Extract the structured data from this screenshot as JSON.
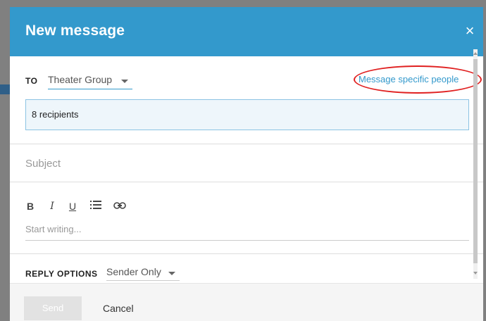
{
  "modal": {
    "title": "New message",
    "close_label": "×"
  },
  "to": {
    "label": "TO",
    "group_value": "Theater Group",
    "specific_link": "Message specific people",
    "recipients_text": "8 recipients"
  },
  "subject": {
    "placeholder": "Subject"
  },
  "toolbar": {
    "bold": "B",
    "italic": "I",
    "underline": "U",
    "list": "☰",
    "link": "⚭"
  },
  "body": {
    "placeholder": "Start writing..."
  },
  "reply_options": {
    "label": "REPLY OPTIONS",
    "value": "Sender Only"
  },
  "footer": {
    "send_label": "Send",
    "cancel_label": "Cancel"
  },
  "colors": {
    "header": "#3399cc",
    "link": "#3399cc",
    "highlight_ring": "#e02020",
    "recipients_bg": "#eef6fb"
  }
}
